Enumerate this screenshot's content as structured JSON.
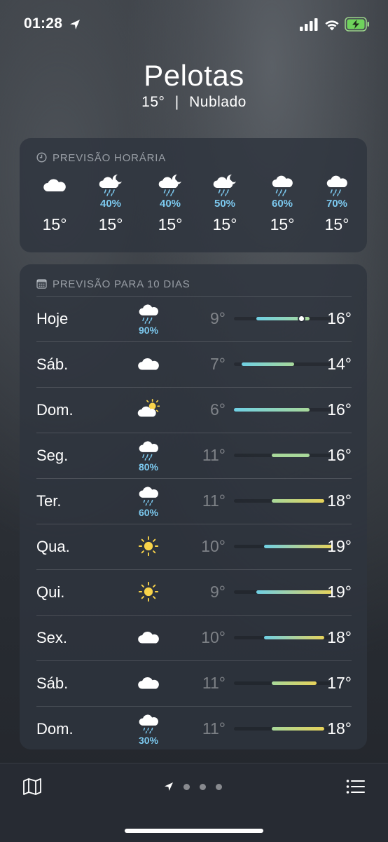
{
  "status_bar": {
    "time": "01:28"
  },
  "header": {
    "city": "Pelotas",
    "temperature": "15°",
    "separator": "|",
    "condition": "Nublado"
  },
  "hourly": {
    "title": "PREVISÃO HORÁRIA",
    "items": [
      {
        "icon": "cloud-icon",
        "pct": "",
        "temp": "15°"
      },
      {
        "icon": "cloud-moon-rain-icon",
        "pct": "40%",
        "temp": "15°"
      },
      {
        "icon": "cloud-moon-rain-icon",
        "pct": "40%",
        "temp": "15°"
      },
      {
        "icon": "cloud-moon-rain-icon",
        "pct": "50%",
        "temp": "15°"
      },
      {
        "icon": "cloud-rain-icon",
        "pct": "60%",
        "temp": "15°"
      },
      {
        "icon": "cloud-rain-icon",
        "pct": "70%",
        "temp": "15°"
      }
    ]
  },
  "daily": {
    "title": "PREVISÃO PARA 10 DIAS",
    "scale_min": 6,
    "scale_max": 19,
    "items": [
      {
        "day": "Hoje",
        "icon": "cloud-rain-icon",
        "pct": "90%",
        "low": "9°",
        "high": "16°",
        "low_v": 9,
        "high_v": 16,
        "current_v": 15
      },
      {
        "day": "Sáb.",
        "icon": "cloud-icon",
        "pct": "",
        "low": "7°",
        "high": "14°",
        "low_v": 7,
        "high_v": 14
      },
      {
        "day": "Dom.",
        "icon": "cloud-sun-icon",
        "pct": "",
        "low": "6°",
        "high": "16°",
        "low_v": 6,
        "high_v": 16
      },
      {
        "day": "Seg.",
        "icon": "cloud-rain-icon",
        "pct": "80%",
        "low": "11°",
        "high": "16°",
        "low_v": 11,
        "high_v": 16
      },
      {
        "day": "Ter.",
        "icon": "cloud-drizzle-icon",
        "pct": "60%",
        "low": "11°",
        "high": "18°",
        "low_v": 11,
        "high_v": 18
      },
      {
        "day": "Qua.",
        "icon": "sun-icon",
        "pct": "",
        "low": "10°",
        "high": "19°",
        "low_v": 10,
        "high_v": 19
      },
      {
        "day": "Qui.",
        "icon": "sun-icon",
        "pct": "",
        "low": "9°",
        "high": "19°",
        "low_v": 9,
        "high_v": 19
      },
      {
        "day": "Sex.",
        "icon": "cloud-icon",
        "pct": "",
        "low": "10°",
        "high": "18°",
        "low_v": 10,
        "high_v": 18
      },
      {
        "day": "Sáb.",
        "icon": "cloud-icon",
        "pct": "",
        "low": "11°",
        "high": "17°",
        "low_v": 11,
        "high_v": 17
      },
      {
        "day": "Dom.",
        "icon": "cloud-drizzle-icon",
        "pct": "30%",
        "low": "11°",
        "high": "18°",
        "low_v": 11,
        "high_v": 18
      }
    ]
  },
  "toolbar": {
    "page_count": 3,
    "current_page": "current-location"
  },
  "colors": {
    "rain_pct": "#7cc9ef",
    "sun": "#f8d34a",
    "cool": "#6fd0e4",
    "mild": "#a8d89a",
    "warm": "#e6d25a"
  }
}
